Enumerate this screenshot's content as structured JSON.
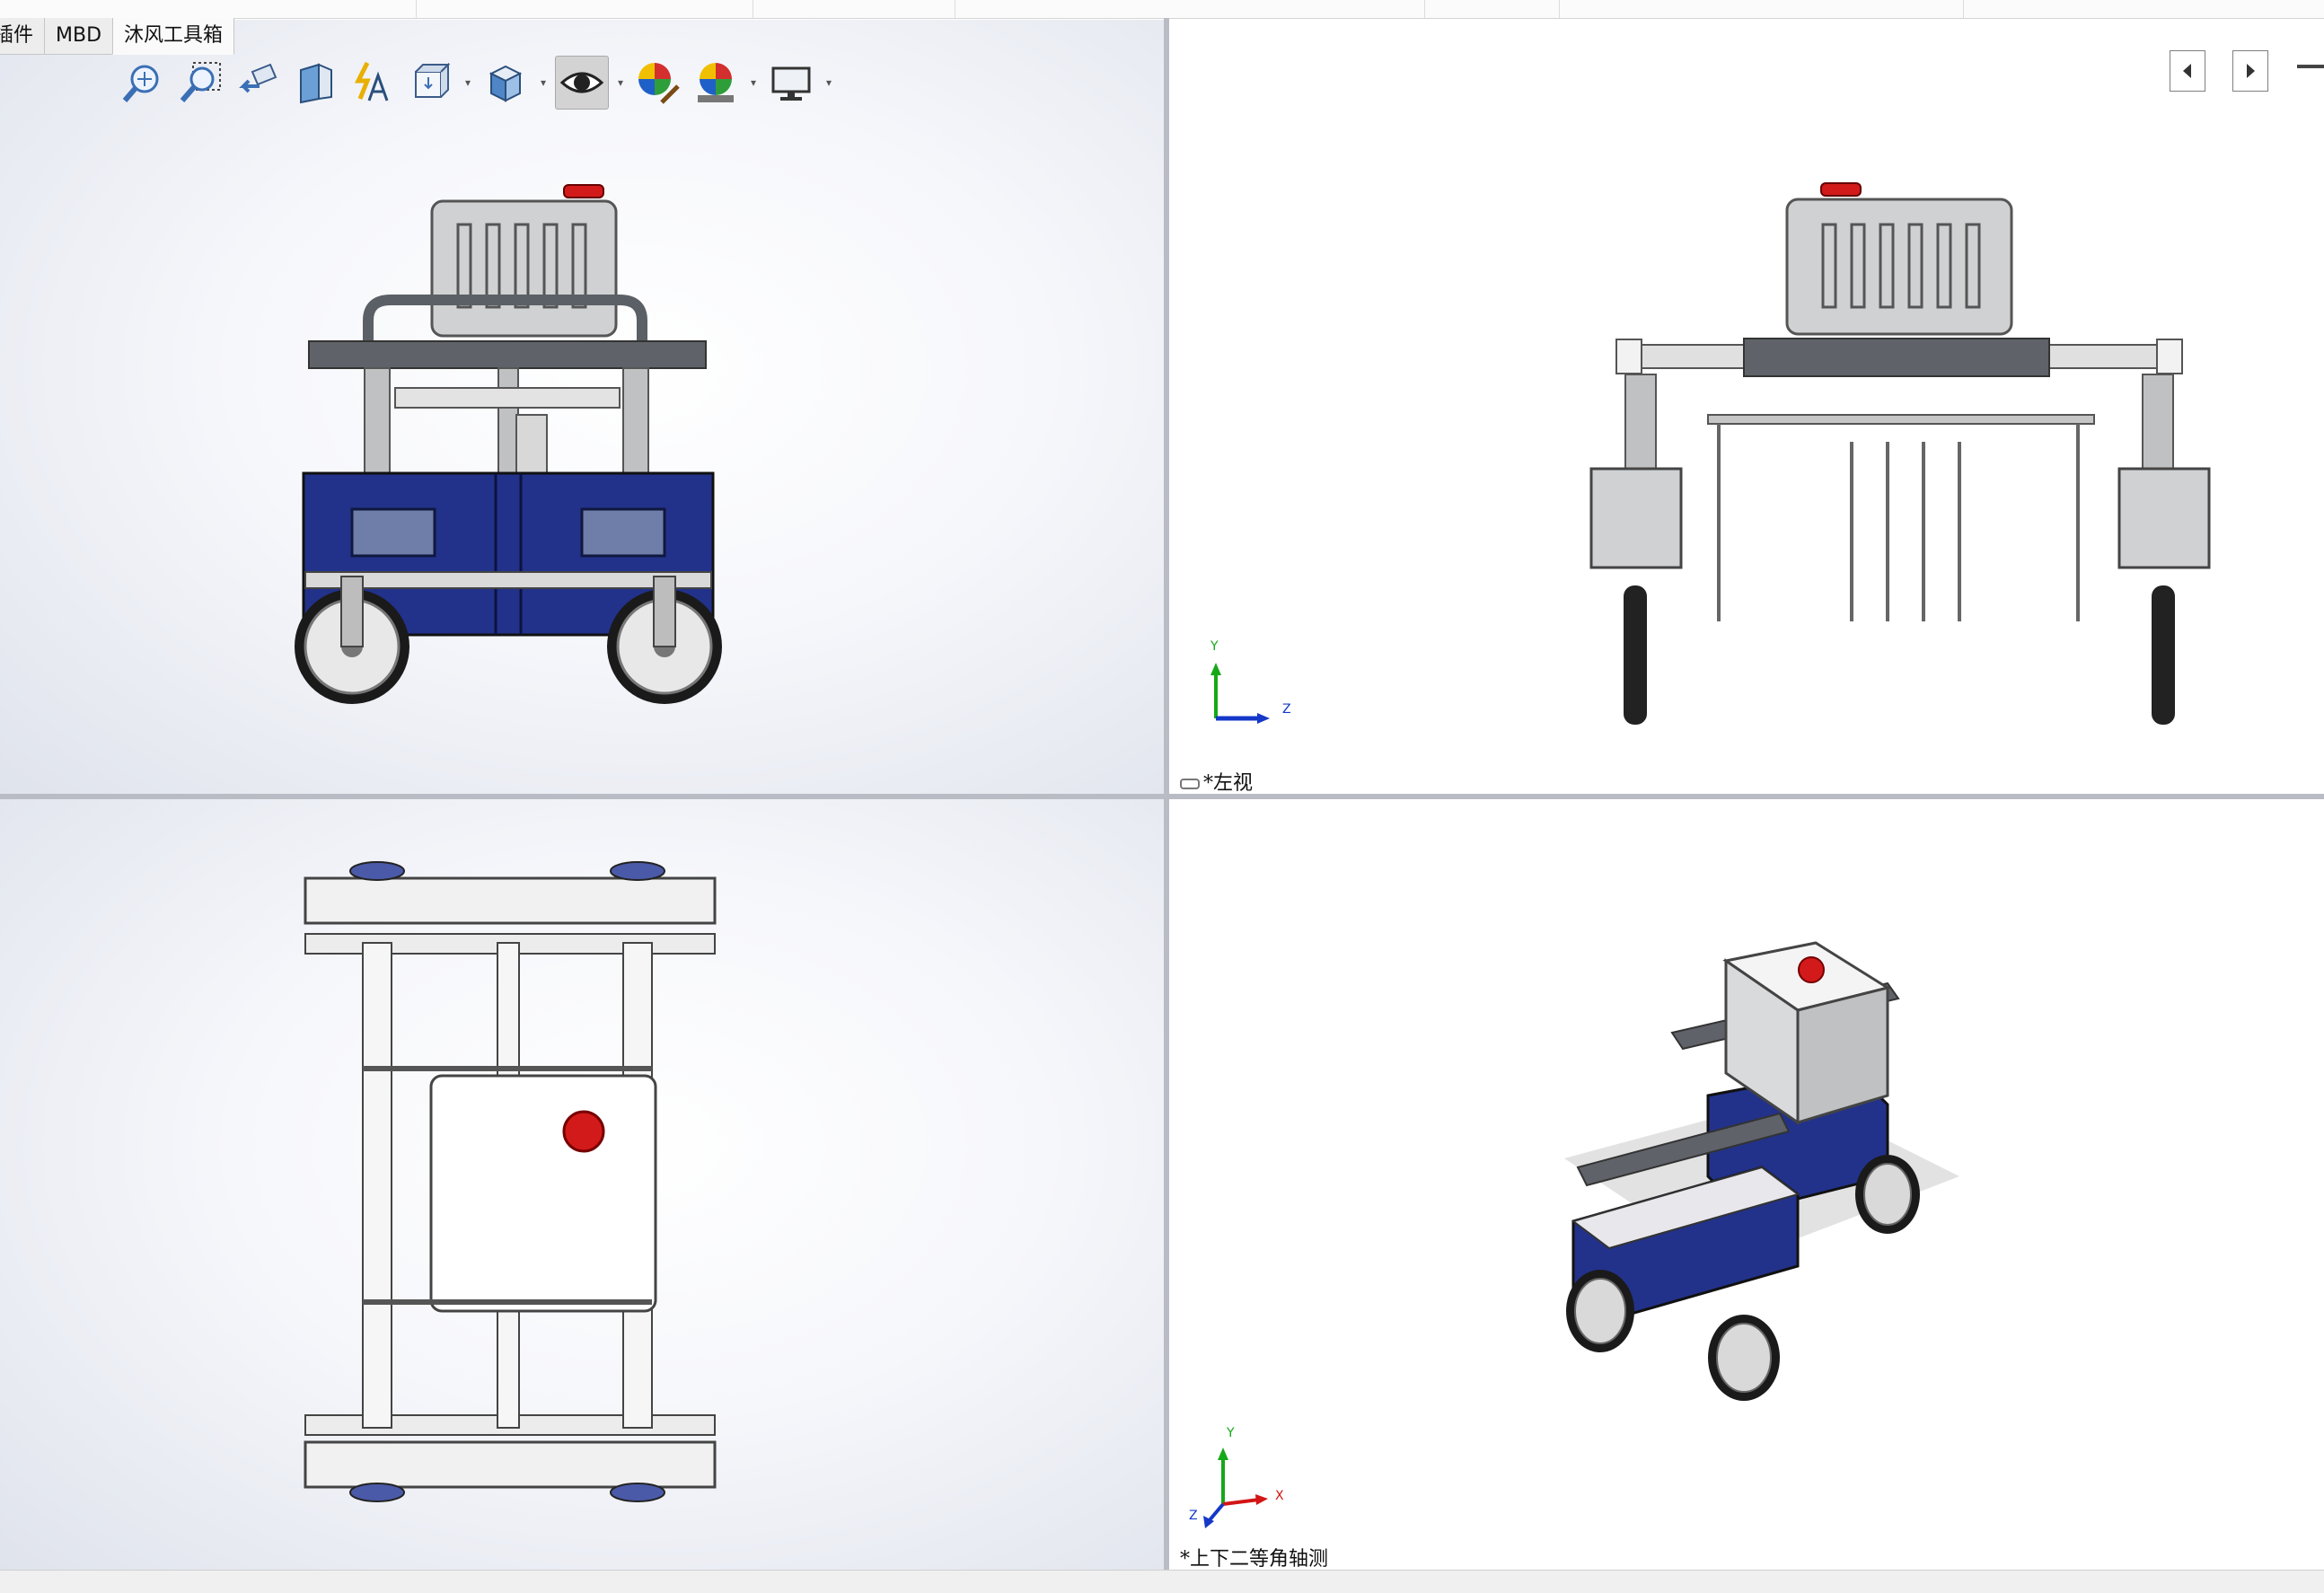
{
  "tabs": [
    {
      "label": "插件",
      "partial": true
    },
    {
      "label": "MBD"
    },
    {
      "label": "沐风工具箱",
      "active": true
    }
  ],
  "toolbar_icons": [
    "zoom-to-fit-icon",
    "zoom-to-area-icon",
    "previous-view-icon",
    "section-view-icon",
    "dynamic-annotation-views-icon",
    "view-orientation-icon",
    "display-style-icon",
    "hide-show-items-icon",
    "edit-appearance-icon",
    "apply-scene-icon",
    "view-settings-icon"
  ],
  "viewports": {
    "top_left": {
      "label": ""
    },
    "top_right": {
      "label": "*左视",
      "triad_axes": [
        "Y",
        "Z"
      ]
    },
    "bottom_left": {
      "label": ""
    },
    "bottom_right": {
      "label": "*上下二等角轴测",
      "triad_axes": [
        "Y",
        "X",
        "Z"
      ]
    }
  },
  "colors": {
    "body_blue": "#22328a",
    "tank_gray": "#c9cbcd",
    "frame_dark": "#555a61",
    "knob_red": "#d21a1a",
    "triad_x": "#d31515",
    "triad_y": "#16a818",
    "triad_z": "#1538c8"
  }
}
